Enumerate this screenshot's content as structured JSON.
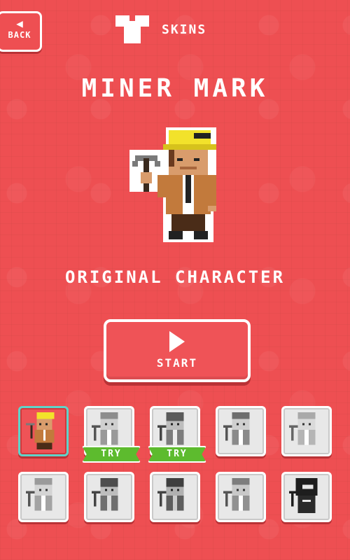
{
  "header": {
    "back_label": "BACK",
    "section_label": "SKINS",
    "icons": [
      "back-arrow-icon",
      "tshirt-icon"
    ]
  },
  "character": {
    "name": "MINER MARK",
    "subtitle": "ORIGINAL CHARACTER"
  },
  "start_button": {
    "label": "START",
    "icon": "play-icon"
  },
  "skins": {
    "try_label": "TRY",
    "items": [
      {
        "id": 1,
        "state": "selected",
        "try": false,
        "shade": "color"
      },
      {
        "id": 2,
        "state": "locked",
        "try": true,
        "shade": "light"
      },
      {
        "id": 3,
        "state": "locked",
        "try": true,
        "shade": "dark"
      },
      {
        "id": 4,
        "state": "locked",
        "try": false,
        "shade": "light"
      },
      {
        "id": 5,
        "state": "locked",
        "try": false,
        "shade": "light"
      },
      {
        "id": 6,
        "state": "locked",
        "try": false,
        "shade": "light"
      },
      {
        "id": 7,
        "state": "locked",
        "try": false,
        "shade": "dark"
      },
      {
        "id": 8,
        "state": "locked",
        "try": false,
        "shade": "dark"
      },
      {
        "id": 9,
        "state": "locked",
        "try": false,
        "shade": "light"
      },
      {
        "id": 10,
        "state": "locked",
        "try": false,
        "shade": "black"
      }
    ]
  },
  "colors": {
    "background": "#ee4f52",
    "selected_border": "#5fd3c9",
    "try_badge": "#5dbb2e",
    "helmet": "#f2e22b"
  }
}
